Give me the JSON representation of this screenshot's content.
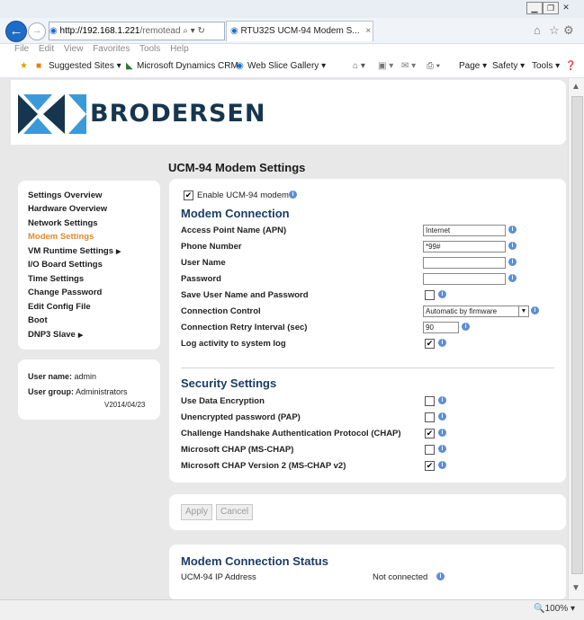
{
  "browser": {
    "address_host": "http://192.168.1.221",
    "address_path": "/remotead",
    "search_glyph": "⌕ ▾ ↻",
    "tab_title": "RTU32S UCM-94 Modem S...",
    "tab_close": "×",
    "menu": [
      "File",
      "Edit",
      "View",
      "Favorites",
      "Tools",
      "Help"
    ],
    "favorites": {
      "suggested": "Suggested Sites ▾",
      "dynamics": "Microsoft Dynamics CRM",
      "slice": "Web Slice Gallery ▾",
      "page": "Page ▾",
      "safety": "Safety ▾",
      "tools": "Tools ▾"
    },
    "zoom": "100%"
  },
  "logo": {
    "text": "BRODERSEN"
  },
  "page_title": "UCM-94 Modem Settings",
  "sidebar": {
    "items": [
      {
        "label": "Settings Overview"
      },
      {
        "label": "Hardware Overview"
      },
      {
        "label": "Network Settings"
      },
      {
        "label": "Modem Settings"
      },
      {
        "label": "VM Runtime Settings"
      },
      {
        "label": "I/O Board Settings"
      },
      {
        "label": "Time Settings"
      },
      {
        "label": "Change Password"
      },
      {
        "label": "Edit Config File"
      },
      {
        "label": "Boot"
      },
      {
        "label": "DNP3 Slave"
      }
    ]
  },
  "user": {
    "name_label": "User name:",
    "name_value": "admin",
    "group_label": "User group:",
    "group_value": "Administrators",
    "version": "V2014/04/23"
  },
  "enable": {
    "label": "Enable UCM-94 modem",
    "checked": "✔"
  },
  "modem": {
    "heading": "Modem Connection",
    "apn_label": "Access Point Name (APN)",
    "apn_value": "Internet",
    "phone_label": "Phone Number",
    "phone_value": "*99#",
    "user_label": "User Name",
    "user_value": "",
    "password_label": "Password",
    "password_value": "",
    "save_label": "Save User Name and Password",
    "save_checked": "",
    "control_label": "Connection Control",
    "control_value": "Automatic by firmware",
    "retry_label": "Connection Retry Interval (sec)",
    "retry_value": "90",
    "log_label": "Log activity to system log",
    "log_checked": "✔"
  },
  "security": {
    "heading": "Security Settings",
    "encryption_label": "Use Data Encryption",
    "encryption_checked": "",
    "pap_label": "Unencrypted password (PAP)",
    "pap_checked": "",
    "chap_label": "Challenge Handshake Authentication Protocol (CHAP)",
    "chap_checked": "✔",
    "mschap_label": "Microsoft CHAP (MS-CHAP)",
    "mschap_checked": "",
    "mschap2_label": "Microsoft CHAP Version 2 (MS-CHAP v2)",
    "mschap2_checked": "✔"
  },
  "actions": {
    "apply": "Apply",
    "cancel": "Cancel"
  },
  "status": {
    "heading": "Modem Connection Status",
    "ip_label": "UCM-94 IP Address",
    "ip_value": "Not connected"
  },
  "icons": {
    "info": "i",
    "dropdown": "▼",
    "submenu_arrow": "▶",
    "back": "←",
    "forward": "→"
  }
}
